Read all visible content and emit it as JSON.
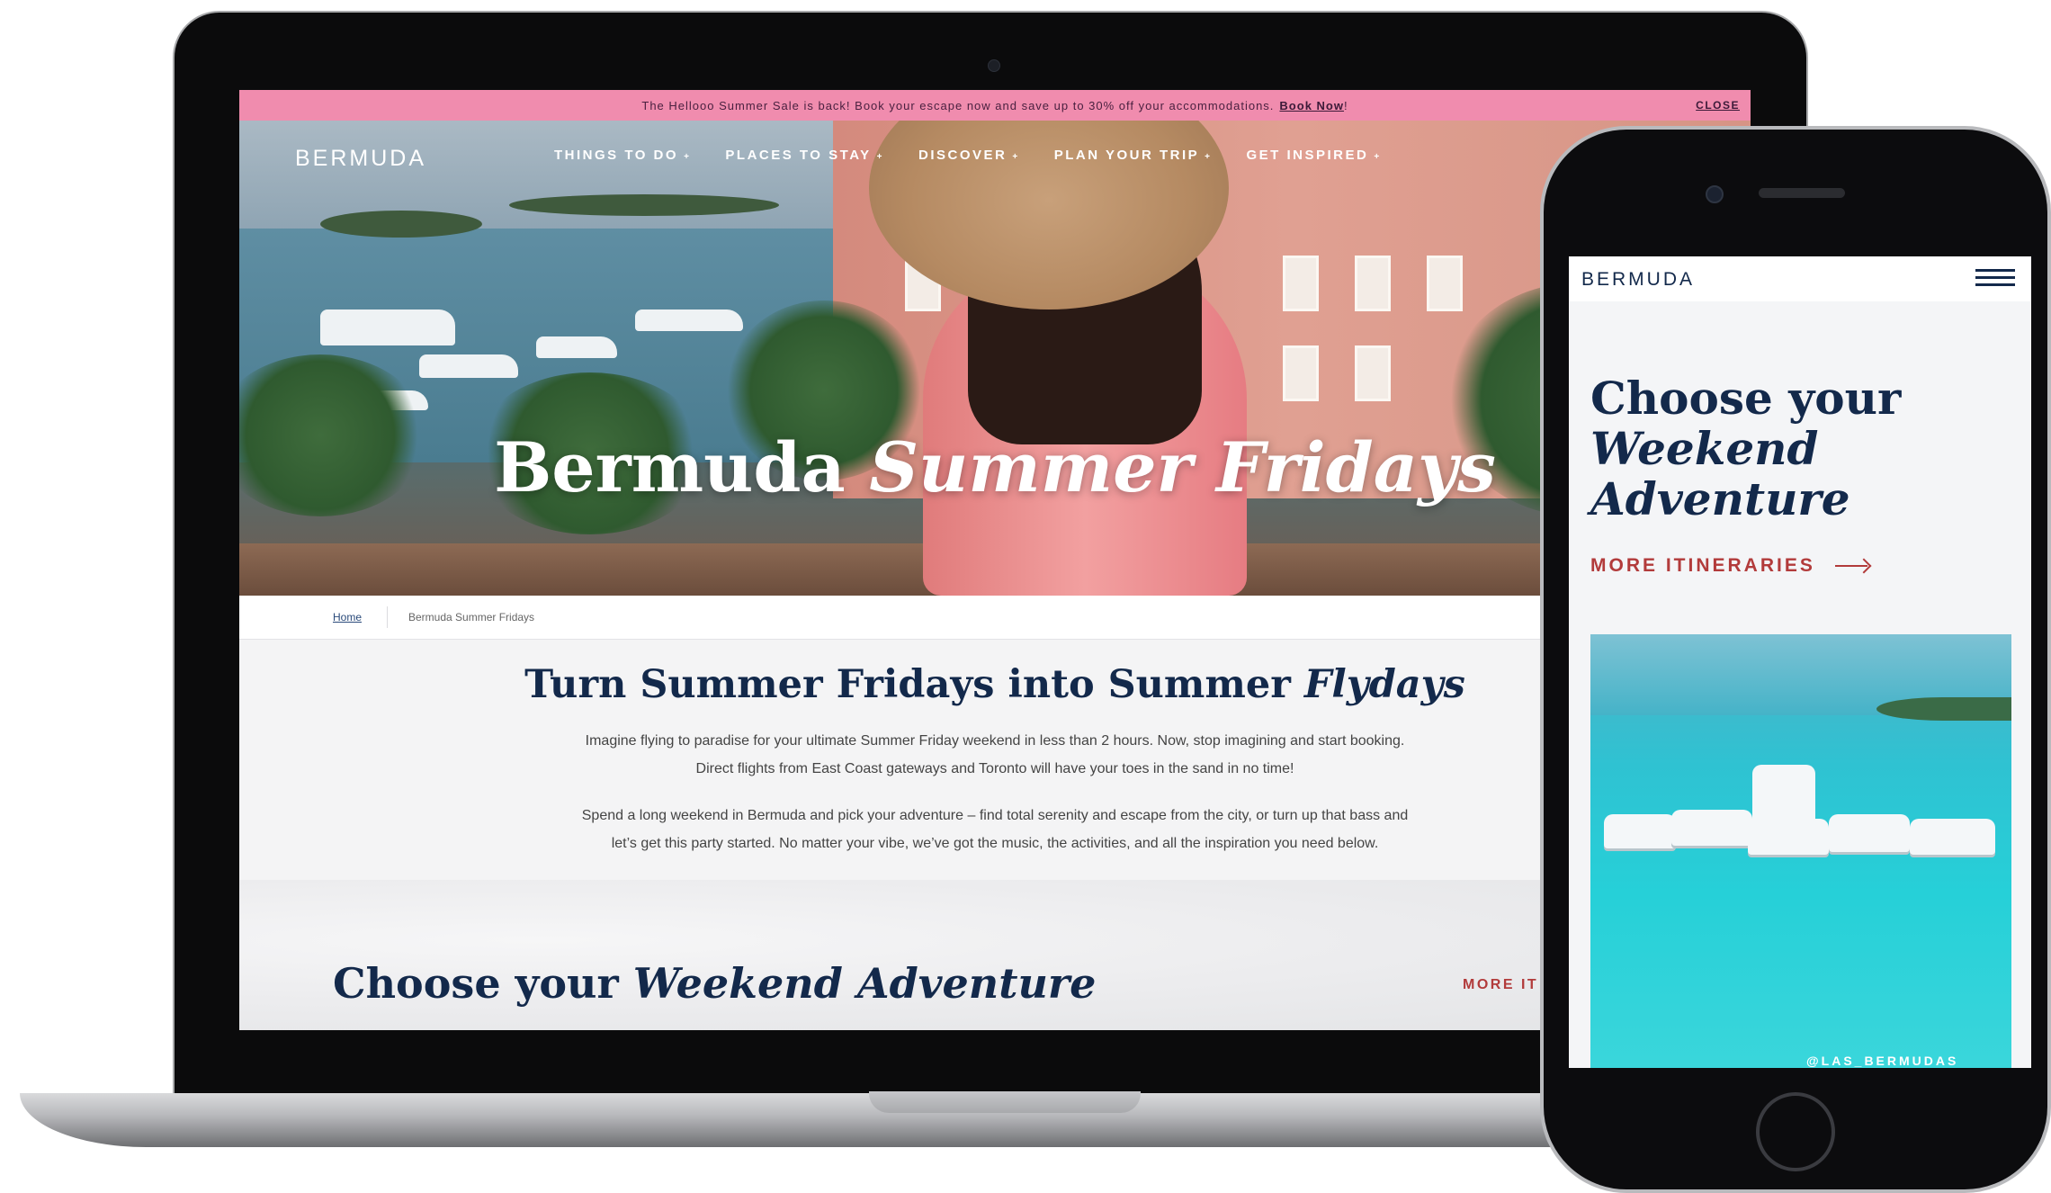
{
  "promo": {
    "message": "The Hellooo Summer Sale is back! Book your escape now and save up to 30% off your accommodations.",
    "link": "Book Now",
    "exclaim": "!",
    "close": "CLOSE"
  },
  "header": {
    "logo": "BERMUDA",
    "nav": [
      {
        "label": "THINGS TO DO",
        "caret": "+"
      },
      {
        "label": "PLACES TO STAY",
        "caret": "+"
      },
      {
        "label": "DISCOVER",
        "caret": "+"
      },
      {
        "label": "PLAN YOUR TRIP",
        "caret": "+"
      },
      {
        "label": "GET INSPIRED",
        "caret": "+"
      }
    ]
  },
  "hero": {
    "title_plain": "Bermuda ",
    "title_italic": "Summer Fridays"
  },
  "breadcrumb": {
    "home": "Home",
    "current": "Bermuda Summer Fridays"
  },
  "intro": {
    "heading_plain": "Turn Summer Fridays into Summer ",
    "heading_italic": "Flydays",
    "p1_line1": "Imagine flying to paradise for your ultimate Summer Friday weekend in less than 2 hours. Now, stop imagining and start booking.",
    "p1_line2": "Direct flights from East Coast gateways and Toronto will have your toes in the sand in no time!",
    "p2_line1": "Spend a long weekend in Bermuda and pick your adventure – find total serenity and escape from the city, or turn up that bass and",
    "p2_line2": "let’s get this party started. No matter your vibe, we’ve got the music, the activities, and all the inspiration you need below."
  },
  "adventure": {
    "title_plain": "Choose your ",
    "title_italic": "Weekend Adventure",
    "more_link_partial": "MORE IT"
  },
  "phone": {
    "logo": "BERMUDA",
    "title_line1": "Choose your",
    "title_line2": "Weekend",
    "title_line3": "Adventure",
    "more_link": "MORE ITINERARIES",
    "photo_caption": "@LAS_BERMUDAS"
  },
  "colors": {
    "promo_bg": "#f08cae",
    "navy": "#13294b",
    "accent_red": "#b23b3b"
  }
}
